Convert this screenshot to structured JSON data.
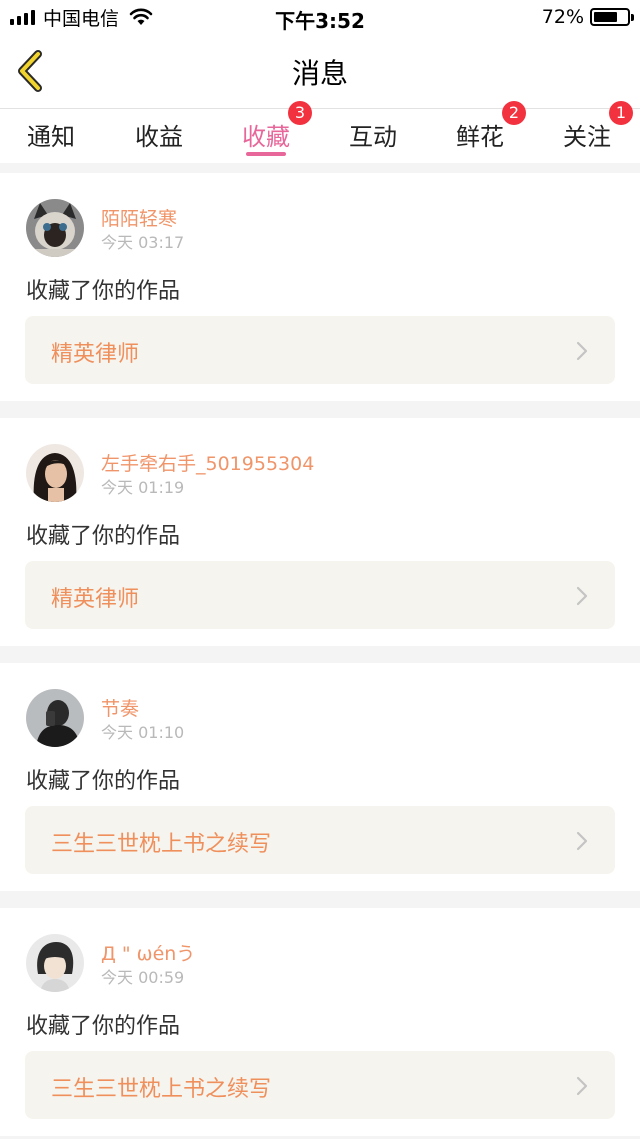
{
  "status_bar": {
    "carrier": "中国电信",
    "time": "下午3:52",
    "battery_percent": "72%",
    "battery_level": 0.72
  },
  "nav": {
    "title": "消息"
  },
  "tabs": [
    {
      "label": "通知",
      "badge": "",
      "active": false
    },
    {
      "label": "收益",
      "badge": "",
      "active": false
    },
    {
      "label": "收藏",
      "badge": "3",
      "active": true
    },
    {
      "label": "互动",
      "badge": "",
      "active": false
    },
    {
      "label": "鲜花",
      "badge": "2",
      "active": false
    },
    {
      "label": "关注",
      "badge": "1",
      "active": false
    }
  ],
  "items": [
    {
      "username": "陌陌轻寒",
      "time": "今天 03:17",
      "action": "收藏了你的作品",
      "work": "精英律师",
      "avatar_icon": "cat-avatar-icon"
    },
    {
      "username": "左手牵右手_501955304",
      "time": "今天 01:19",
      "action": "收藏了你的作品",
      "work": "精英律师",
      "avatar_icon": "woman-avatar-icon"
    },
    {
      "username": "节奏",
      "time": "今天 01:10",
      "action": "收藏了你的作品",
      "work": "三生三世枕上书之续写",
      "avatar_icon": "selfie-avatar-icon"
    },
    {
      "username": "Д \" ωénう",
      "time": "今天 00:59",
      "action": "收藏了你的作品",
      "work": "三生三世枕上书之续写",
      "avatar_icon": "person-avatar-icon"
    }
  ],
  "colors": {
    "accent_pink": "#e8679b",
    "username_orange": "#f0956a",
    "badge_red": "#f2323f",
    "link_bg": "#f6f4ee",
    "back_arrow": "#f2d42e"
  }
}
